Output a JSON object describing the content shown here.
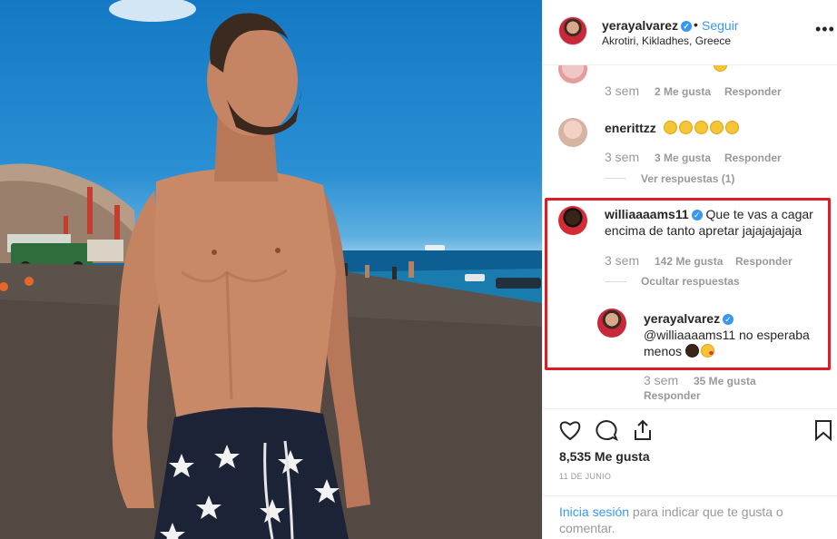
{
  "colors": {
    "accent": "#3897f0",
    "highlight": "#e21a22",
    "muted": "#999999",
    "text": "#262626"
  },
  "post": {
    "author": "yerayalvarez",
    "follow_label": "Seguir",
    "dot": "•",
    "location": "Akrotiri, Kikladhes, Greece",
    "more_icon": "more-horizontal-icon"
  },
  "comments": [
    {
      "id": "c1",
      "time": "3 sem",
      "likes": "2 Me gusta",
      "reply": "Responder"
    },
    {
      "id": "c2",
      "user": "enerittzz",
      "time": "3 sem",
      "likes": "3 Me gusta",
      "reply": "Responder",
      "view_replies": "Ver respuestas (1)",
      "emoji_count": 5
    },
    {
      "id": "c3",
      "user": "williaaaams11",
      "verified": true,
      "text": "Que te vas a cagar encima de tanto apretar jajajajajaja",
      "time": "3 sem",
      "likes": "142 Me gusta",
      "reply": "Responder",
      "hide_replies": "Ocultar respuestas",
      "replies": [
        {
          "user": "yerayalvarez",
          "verified": true,
          "text": "@williaaaams11 no esperaba menos",
          "time": "3 sem",
          "likes": "35 Me gusta",
          "reply": "Responder"
        }
      ]
    }
  ],
  "actions": {
    "like_icon": "heart-icon",
    "comment_icon": "comment-icon",
    "share_icon": "share-icon",
    "save_icon": "bookmark-icon",
    "likes_count": "8,535 Me gusta",
    "date": "11 DE JUNIO",
    "login_link": "Inicia sesión",
    "login_rest": " para indicar que te gusta o comentar."
  }
}
